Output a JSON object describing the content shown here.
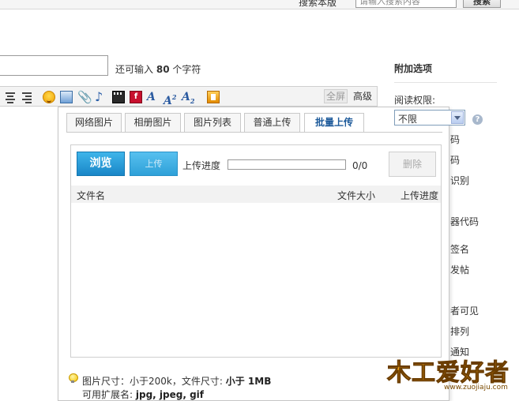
{
  "search": {
    "label": "搜索本版",
    "placeholder": "请输入搜索内容",
    "button": "搜索"
  },
  "title_field": {
    "hint_prefix": "还可输入",
    "hint_count": "80",
    "hint_suffix": "个字符"
  },
  "toolbar": {
    "fullscreen": "全屏",
    "advanced": "高级"
  },
  "upload_dialog": {
    "tabs": [
      "网络图片",
      "相册图片",
      "图片列表",
      "普通上传",
      "批量上传"
    ],
    "active_tab": "批量上传",
    "browse": "浏览",
    "upload": "上传",
    "progress_label": "上传进度",
    "progress_fraction": 0,
    "progress_count": "0/0",
    "delete": "删除",
    "columns": {
      "name": "文件名",
      "size": "文件大小",
      "progress": "上传进度"
    },
    "note_line1_prefix": "图片尺寸：小于200k，文件尺寸:",
    "note_line1_bold": "小于 1MB",
    "note_line2_prefix": "可用扩展名:",
    "note_line2_bold": "jpg, jpeg, gif"
  },
  "sidebar": {
    "title": "附加选项",
    "read_permission_label": "阅读权限:",
    "read_permission_value": "不限",
    "options_partial": [
      "码",
      "码",
      "识别",
      "器代码",
      "签名",
      "发帖",
      "者可见",
      "排列",
      "通知"
    ]
  },
  "watermark": {
    "text": "木工爱好者",
    "url": "www.zuojiaju.com"
  }
}
